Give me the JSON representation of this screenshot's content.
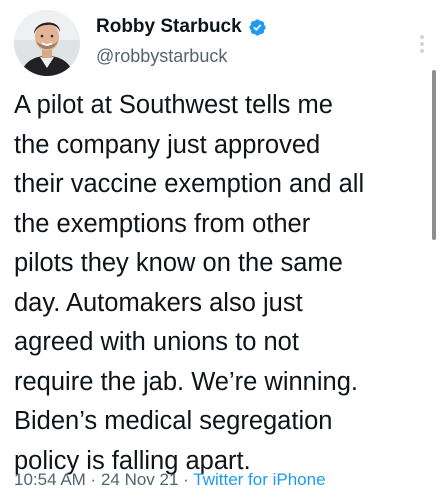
{
  "author": {
    "display_name": "Robby Starbuck",
    "handle": "@robbystarbuck",
    "verified": true,
    "avatar_icon": "user-avatar-photo"
  },
  "tweet": {
    "lines": [
      "A pilot at Southwest tells me",
      "the company just approved",
      "their vaccine exemption and all",
      "the exemptions from other",
      "pilots they know on the same",
      "day. Automakers also just",
      "agreed with unions to not",
      "require the jab. We’re winning.",
      "Biden’s medical segregation",
      "policy is falling apart."
    ]
  },
  "meta": {
    "time": "10:54 AM",
    "separator": " · ",
    "date": "24 Nov 21",
    "source": "Twitter for iPhone"
  },
  "colors": {
    "text": "#0f1419",
    "secondary": "#536471",
    "accent": "#1d9bf0"
  },
  "icons": {
    "verified": "verified-badge-icon",
    "more": "more-options-icon"
  }
}
